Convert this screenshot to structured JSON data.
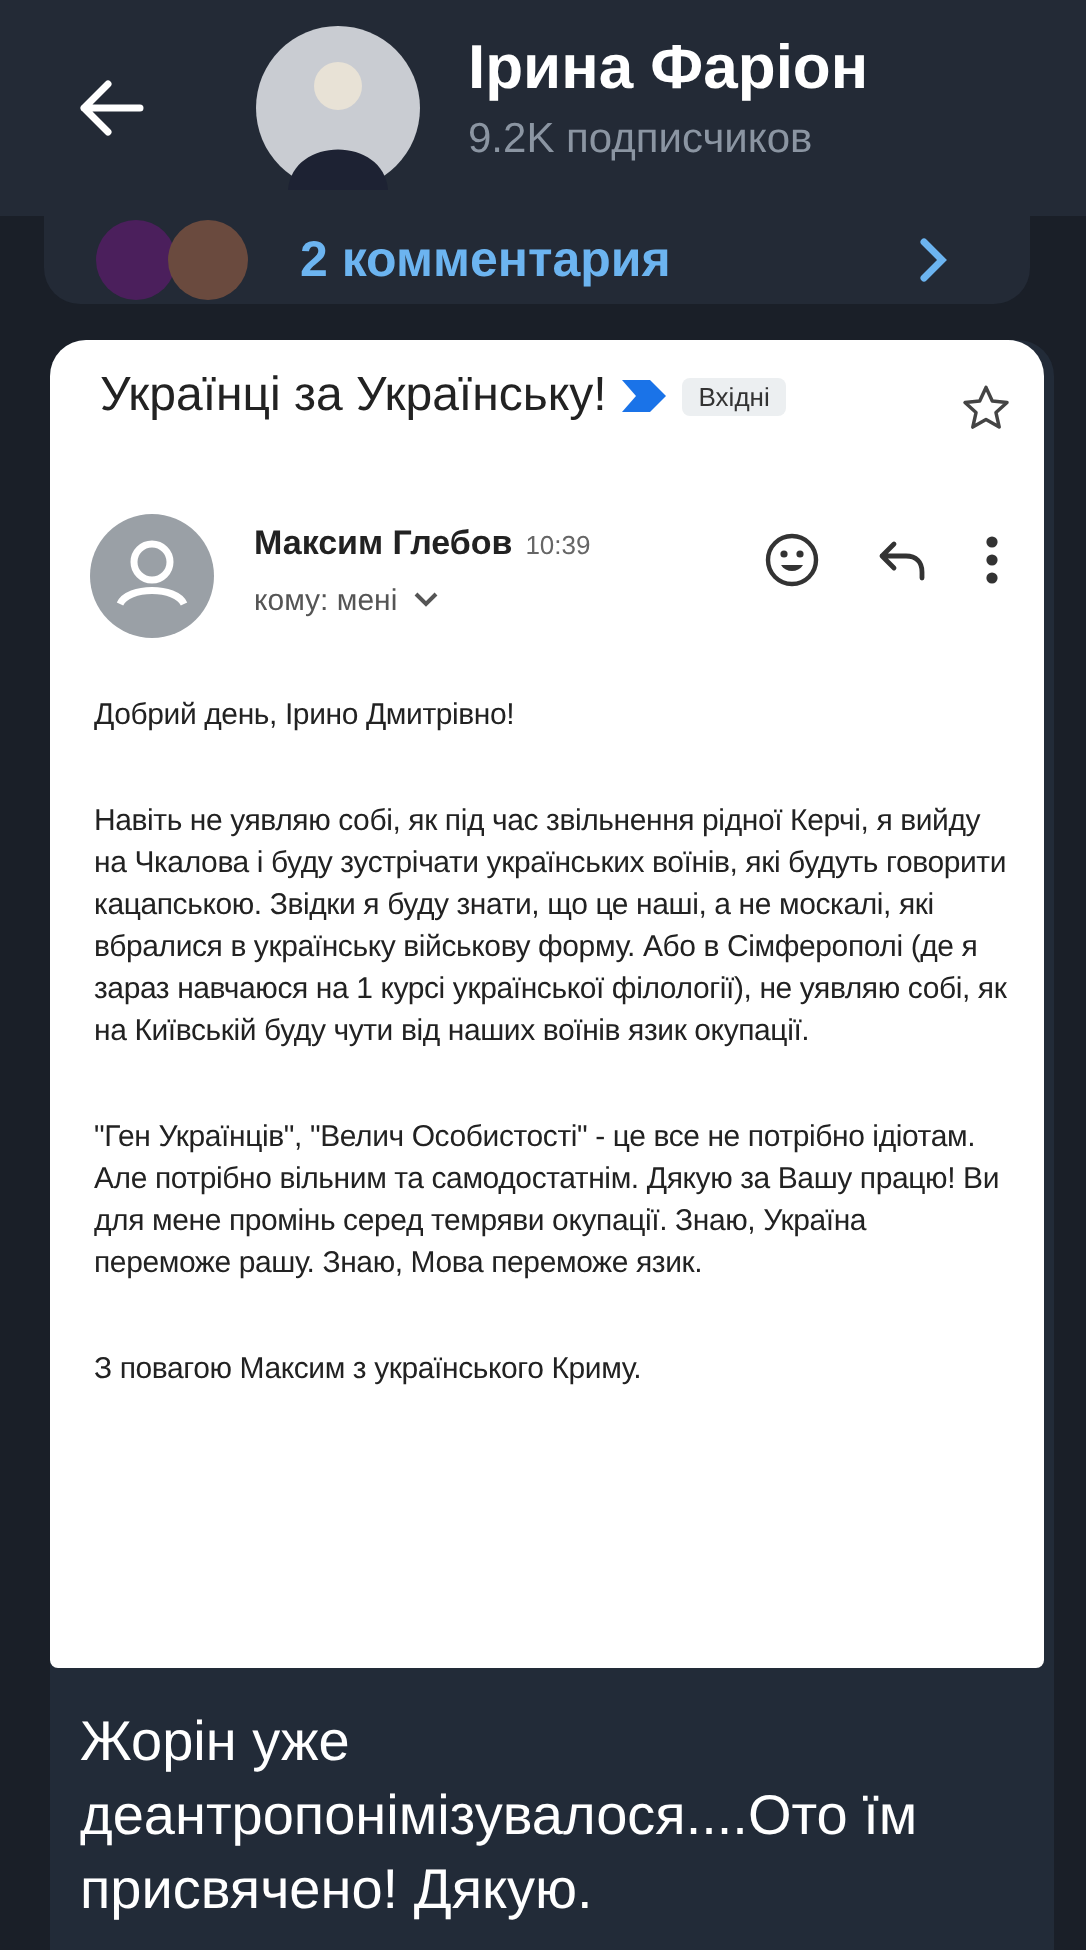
{
  "header": {
    "title": "Ірина Фаріон",
    "subtitle": "9.2K подписчиков"
  },
  "comments": {
    "label": "2 комментария"
  },
  "message": {
    "email": {
      "subject": "Українці за Українську!",
      "label": "Вхідні",
      "sender": "Максим Глебов",
      "time": "10:39",
      "recipient": "кому: мені",
      "paragraphs": [
        "Добрий день, Ірино Дмитрівно!",
        "Навіть не уявляю собі, як під час звільнення рідної Керчі, я вийду на Чкалова і буду зустрічати українських воїнів, які будуть говорити кацапською. Звідки я буду знати, що це наші, а не москалі, які вбралися в українську військову форму. Або в Сімферополі (де я зараз навчаюся на 1 курсі української філології), не уявляю собі, як на Київській буду чути від наших воїнів язик окупації.",
        "\"Ген Українців\", \"Велич Особистості\" - це все не потрібно ідіотам. Але потрібно вільним та самодостатнім. Дякую за Вашу працю! Ви для мене промінь серед темряви окупації.  Знаю, Україна переможе рашу. Знаю, Мова переможе язик.",
        "З повагою Максим з українського Криму."
      ]
    },
    "caption": "Жорін уже деантропонімізувалося....Ото їм присвячено! Дякую."
  }
}
